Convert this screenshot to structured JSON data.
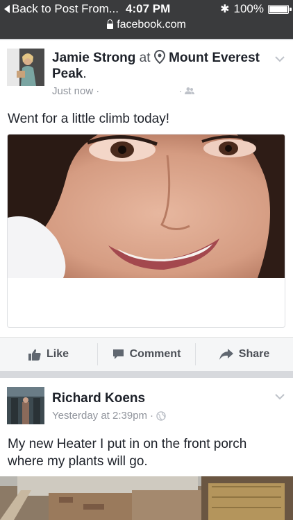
{
  "status_bar": {
    "back_label": "Back to Post From...",
    "time": "4:07 PM",
    "battery": "100%",
    "url": "facebook.com"
  },
  "posts": [
    {
      "author": "Jamie Strong",
      "at_word": "at",
      "location": "Mount Everest Peak",
      "location_suffix": ".",
      "timestamp": "Just now",
      "text": "Went for a little climb today!",
      "privacy_icon": "friends-icon"
    },
    {
      "author": "Richard Koens",
      "timestamp": "Yesterday at 2:39pm",
      "text": "My new Heater I put in on the front porch where my plants will go.",
      "privacy_icon": "globe-icon"
    }
  ],
  "actions": {
    "like": "Like",
    "comment": "Comment",
    "share": "Share"
  },
  "colors": {
    "status_bar": "#3a3b3d",
    "text": "#1d2129",
    "meta": "#90949c",
    "action_text": "#4b4f56"
  }
}
